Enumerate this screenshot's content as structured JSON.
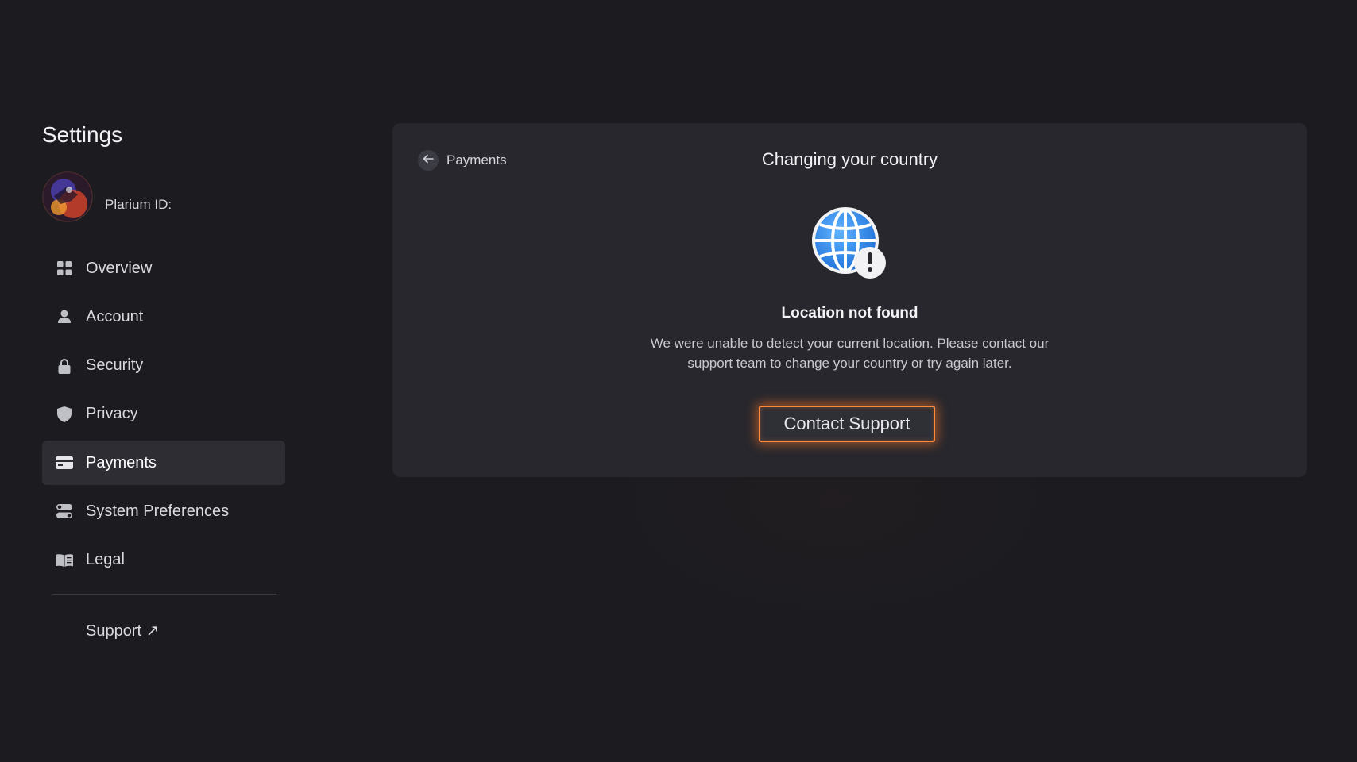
{
  "sidebar": {
    "title": "Settings",
    "profile": {
      "id_label": "Plarium ID:"
    },
    "items": [
      {
        "label": "Overview",
        "icon": "grid-icon",
        "active": false
      },
      {
        "label": "Account",
        "icon": "user-icon",
        "active": false
      },
      {
        "label": "Security",
        "icon": "lock-icon",
        "active": false
      },
      {
        "label": "Privacy",
        "icon": "shield-icon",
        "active": false
      },
      {
        "label": "Payments",
        "icon": "card-icon",
        "active": true
      },
      {
        "label": "System Preferences",
        "icon": "toggles-icon",
        "active": false
      },
      {
        "label": "Legal",
        "icon": "book-icon",
        "active": false
      }
    ],
    "support": {
      "label": "Support ↗"
    }
  },
  "main": {
    "breadcrumb": "Payments",
    "title": "Changing your country",
    "status_title": "Location not found",
    "message": "We were unable to detect your current location. Please contact our support team to change your country or try again later.",
    "contact_button": "Contact Support"
  },
  "colors": {
    "background": "#1b1b20",
    "card": "#27272d",
    "accent_glow": "#ff8a3c",
    "globe": "#2f8cf0"
  }
}
